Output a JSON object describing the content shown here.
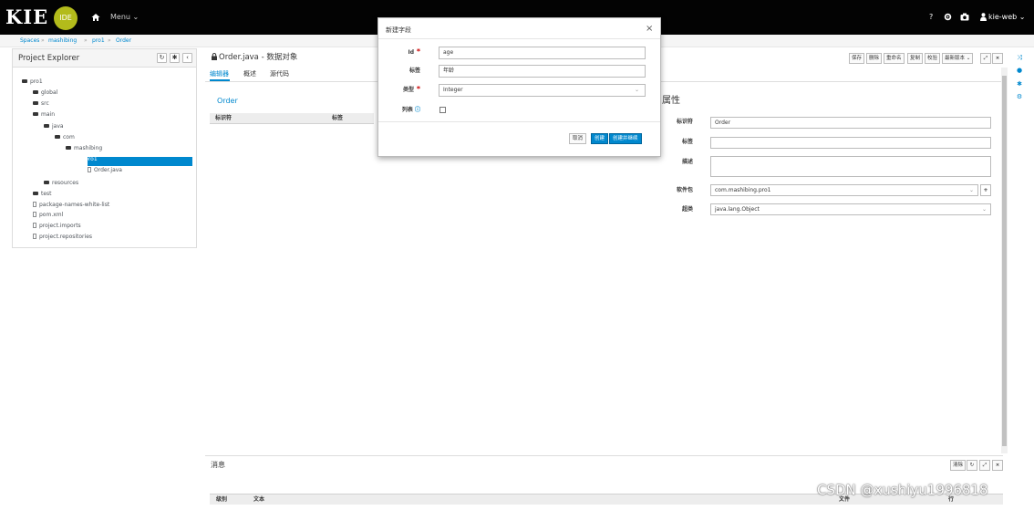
{
  "navbar": {
    "logo_text": "KIE",
    "logo_badge": "IDE",
    "menu_label": "Menu ⌄",
    "help_label": "?",
    "user_label": "kie-web ⌄"
  },
  "breadcrumb": [
    "Spaces",
    "mashibing",
    "pro1",
    "Order"
  ],
  "explorer": {
    "title": "Project Explorer",
    "tree": [
      {
        "label": "pro1",
        "type": "folder",
        "depth": 0
      },
      {
        "label": "global",
        "type": "folder",
        "depth": 1
      },
      {
        "label": "src",
        "type": "folder",
        "depth": 1
      },
      {
        "label": "main",
        "type": "folder",
        "depth": 2
      },
      {
        "label": "java",
        "type": "folder",
        "depth": 3
      },
      {
        "label": "com",
        "type": "folder",
        "depth": 4
      },
      {
        "label": "mashibing",
        "type": "folder",
        "depth": 5
      },
      {
        "label": "pro1",
        "type": "folder",
        "depth": 6,
        "selected": true
      },
      {
        "label": "Order.java",
        "type": "file",
        "depth": 7
      },
      {
        "label": "resources",
        "type": "folder",
        "depth": 3
      },
      {
        "label": "test",
        "type": "folder",
        "depth": 1
      },
      {
        "label": "package-names-white-list",
        "type": "file",
        "depth": 1
      },
      {
        "label": "pom.xml",
        "type": "file",
        "depth": 1
      },
      {
        "label": "project.imports",
        "type": "file",
        "depth": 1
      },
      {
        "label": "project.repositories",
        "type": "file",
        "depth": 1
      }
    ]
  },
  "editor": {
    "title": "Order.java - 数据对象",
    "tabs": [
      "编辑器",
      "概述",
      "源代码"
    ],
    "object_name": "Order",
    "columns": [
      "标识符",
      "标签"
    ]
  },
  "toolbar": [
    "保存",
    "删除",
    "重命名",
    "复制",
    "校验",
    "最新版本 ⌄"
  ],
  "properties": {
    "title": "属性",
    "identifier_label": "标识符",
    "identifier_value": "Order",
    "label_label": "标签",
    "label_value": "",
    "desc_label": "描述",
    "desc_value": "",
    "package_label": "软件包",
    "package_value": "com.mashibing.pro1",
    "superclass_label": "超类",
    "superclass_value": "java.lang.Object"
  },
  "messages": {
    "title": "消息",
    "clear_label": "清除",
    "col_level": "级别",
    "col_text": "文本",
    "col_file": "文件",
    "col_row": "行"
  },
  "modal": {
    "title": "新建字段",
    "id_label": "Id",
    "id_value": "age",
    "label_label": "标签",
    "label_value": "年龄",
    "type_label": "类型",
    "type_value": "Integer",
    "list_label": "列表",
    "cancel_label": "取消",
    "create_label": "创建",
    "create_continue_label": "创建并继续"
  },
  "watermark": "CSDN @xushiyu1996818",
  "colors": {
    "accent": "#0088ce",
    "navbar": "#030303",
    "logo_badge": "#b3bb1b"
  }
}
